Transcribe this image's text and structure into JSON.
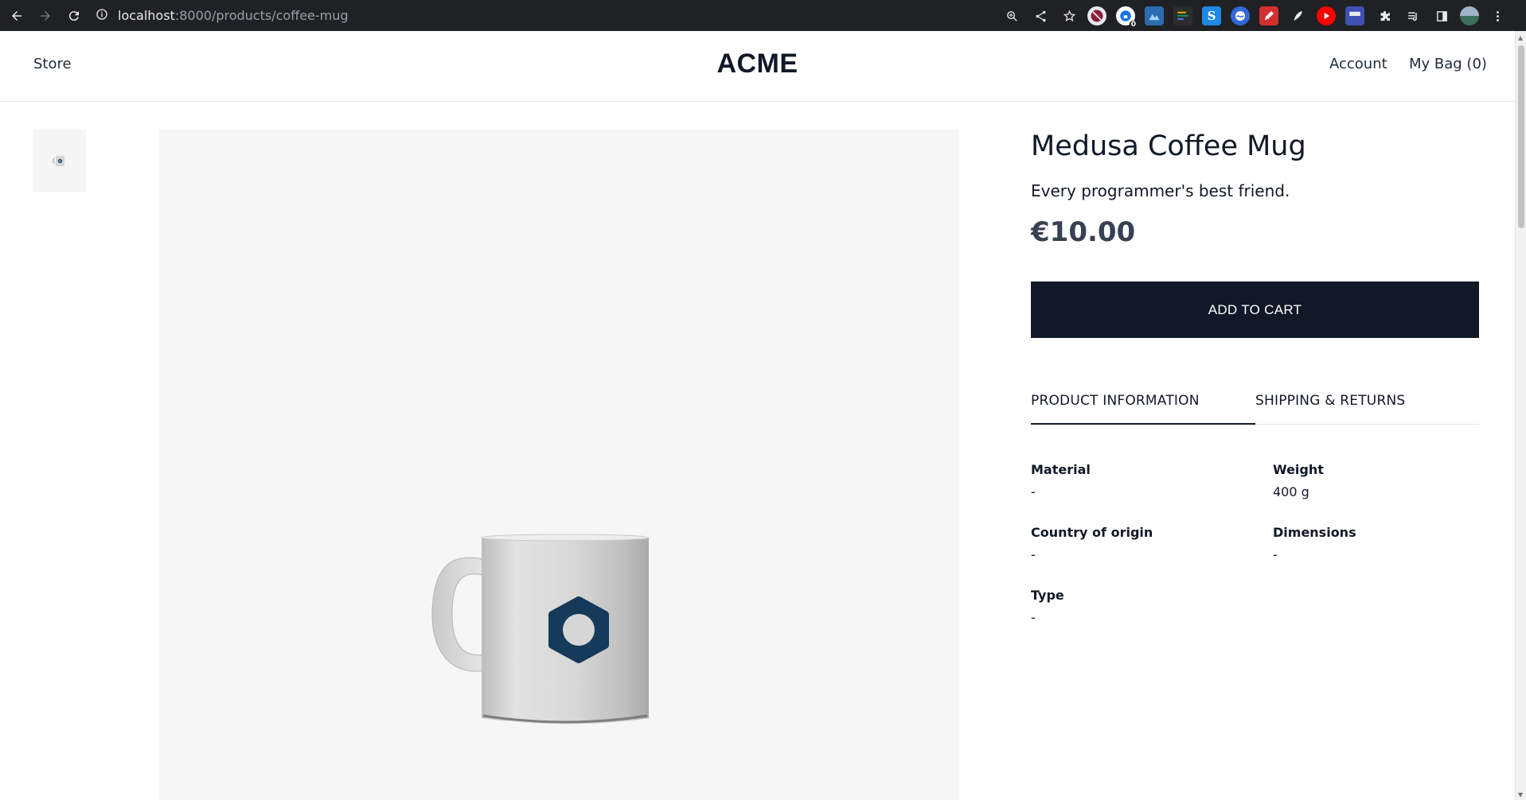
{
  "browser": {
    "url_host": "localhost",
    "url_path": ":8000/products/coffee-mug",
    "extension_badge": "0"
  },
  "header": {
    "store_label": "Store",
    "logo": "ACME",
    "account_label": "Account",
    "bag_label": "My Bag (0)"
  },
  "product": {
    "title": "Medusa Coffee Mug",
    "subtitle": "Every programmer's best friend.",
    "price": "€10.00",
    "add_to_cart_label": "ADD TO CART"
  },
  "tabs": [
    {
      "label": "PRODUCT INFORMATION",
      "active": true
    },
    {
      "label": "SHIPPING & RETURNS",
      "active": false
    }
  ],
  "specs": {
    "material": {
      "label": "Material",
      "value": "-"
    },
    "weight": {
      "label": "Weight",
      "value": "400 g"
    },
    "country": {
      "label": "Country of origin",
      "value": "-"
    },
    "dimensions": {
      "label": "Dimensions",
      "value": "-"
    },
    "type": {
      "label": "Type",
      "value": "-"
    }
  },
  "colors": {
    "primary_button": "#111827",
    "logo_hex": "#163a5a",
    "image_background": "#f6f6f7"
  }
}
